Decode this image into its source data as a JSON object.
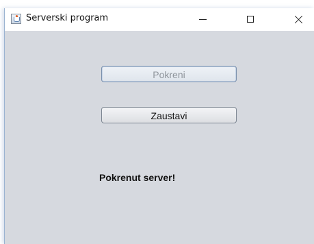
{
  "window": {
    "title": "Serverski program",
    "app_icon": "java-cup-icon",
    "controls": [
      "minimize-icon",
      "maximize-icon",
      "close-icon"
    ]
  },
  "buttons": {
    "start_label": "Pokreni",
    "start_enabled": false,
    "stop_label": "Zaustavi",
    "stop_enabled": true
  },
  "status": {
    "text": "Pokrenut server!"
  },
  "colors": {
    "content_background": "#d6d9df",
    "titlebar_background": "#ffffff",
    "disabled_text": "#8f959c"
  }
}
